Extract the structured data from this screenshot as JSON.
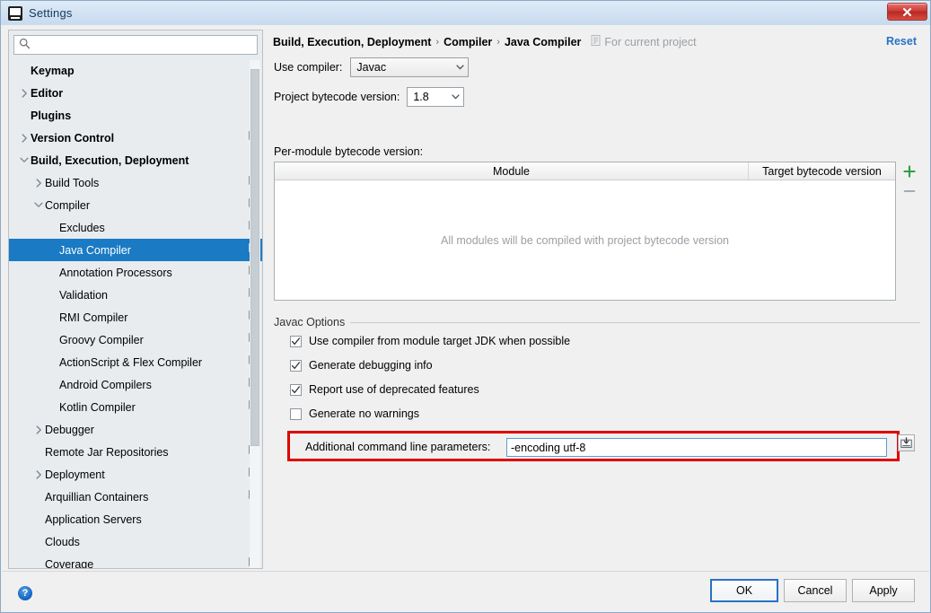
{
  "window": {
    "title": "Settings",
    "app_icon": "intellij-idea-icon",
    "close_label": "close-icon"
  },
  "sidebar": {
    "search": {
      "value": "",
      "placeholder": ""
    },
    "items": [
      {
        "label": "Keymap",
        "indent": 0,
        "arrow": "none",
        "bold": true,
        "copy": false,
        "selected": false
      },
      {
        "label": "Editor",
        "indent": 0,
        "arrow": "collapsed",
        "bold": true,
        "copy": false,
        "selected": false
      },
      {
        "label": "Plugins",
        "indent": 0,
        "arrow": "none",
        "bold": true,
        "copy": false,
        "selected": false
      },
      {
        "label": "Version Control",
        "indent": 0,
        "arrow": "collapsed",
        "bold": true,
        "copy": true,
        "selected": false
      },
      {
        "label": "Build, Execution, Deployment",
        "indent": 0,
        "arrow": "expanded",
        "bold": true,
        "copy": false,
        "selected": false
      },
      {
        "label": "Build Tools",
        "indent": 1,
        "arrow": "collapsed",
        "bold": false,
        "copy": true,
        "selected": false
      },
      {
        "label": "Compiler",
        "indent": 1,
        "arrow": "expanded",
        "bold": false,
        "copy": true,
        "selected": false
      },
      {
        "label": "Excludes",
        "indent": 2,
        "arrow": "none",
        "bold": false,
        "copy": true,
        "selected": false
      },
      {
        "label": "Java Compiler",
        "indent": 2,
        "arrow": "none",
        "bold": false,
        "copy": true,
        "selected": true
      },
      {
        "label": "Annotation Processors",
        "indent": 2,
        "arrow": "none",
        "bold": false,
        "copy": true,
        "selected": false
      },
      {
        "label": "Validation",
        "indent": 2,
        "arrow": "none",
        "bold": false,
        "copy": true,
        "selected": false
      },
      {
        "label": "RMI Compiler",
        "indent": 2,
        "arrow": "none",
        "bold": false,
        "copy": true,
        "selected": false
      },
      {
        "label": "Groovy Compiler",
        "indent": 2,
        "arrow": "none",
        "bold": false,
        "copy": true,
        "selected": false
      },
      {
        "label": "ActionScript & Flex Compiler",
        "indent": 2,
        "arrow": "none",
        "bold": false,
        "copy": true,
        "selected": false
      },
      {
        "label": "Android Compilers",
        "indent": 2,
        "arrow": "none",
        "bold": false,
        "copy": true,
        "selected": false
      },
      {
        "label": "Kotlin Compiler",
        "indent": 2,
        "arrow": "none",
        "bold": false,
        "copy": true,
        "selected": false
      },
      {
        "label": "Debugger",
        "indent": 1,
        "arrow": "collapsed",
        "bold": false,
        "copy": false,
        "selected": false
      },
      {
        "label": "Remote Jar Repositories",
        "indent": 1,
        "arrow": "none",
        "bold": false,
        "copy": true,
        "selected": false
      },
      {
        "label": "Deployment",
        "indent": 1,
        "arrow": "collapsed",
        "bold": false,
        "copy": true,
        "selected": false
      },
      {
        "label": "Arquillian Containers",
        "indent": 1,
        "arrow": "none",
        "bold": false,
        "copy": true,
        "selected": false
      },
      {
        "label": "Application Servers",
        "indent": 1,
        "arrow": "none",
        "bold": false,
        "copy": false,
        "selected": false
      },
      {
        "label": "Clouds",
        "indent": 1,
        "arrow": "none",
        "bold": false,
        "copy": false,
        "selected": false
      },
      {
        "label": "Coverage",
        "indent": 1,
        "arrow": "none",
        "bold": false,
        "copy": true,
        "selected": false
      }
    ]
  },
  "main": {
    "breadcrumb": [
      "Build, Execution, Deployment",
      "Compiler",
      "Java Compiler"
    ],
    "breadcrumb_separator": "›",
    "scope_label": "For current project",
    "scope_icon": "project-scope-icon",
    "reset_label": "Reset",
    "use_compiler": {
      "label": "Use compiler:",
      "value": "Javac"
    },
    "project_bytecode": {
      "label": "Project bytecode version:",
      "value": "1.8"
    },
    "per_module": {
      "label": "Per-module bytecode version:",
      "columns": [
        "Module",
        "Target bytecode version"
      ],
      "empty_text": "All modules will be compiled with project bytecode version",
      "add_label": "+",
      "remove_label": "−"
    },
    "javac_options": {
      "title": "Javac Options",
      "checkboxes": [
        {
          "label": "Use compiler from module target JDK when possible",
          "checked": true
        },
        {
          "label": "Generate debugging info",
          "checked": true
        },
        {
          "label": "Report use of deprecated features",
          "checked": true
        },
        {
          "label": "Generate no warnings",
          "checked": false
        }
      ],
      "additional_params": {
        "label": "Additional command line parameters:",
        "value": "-encoding utf-8",
        "placeholder": "",
        "expand_icon": "insert-macro-icon"
      }
    }
  },
  "footer": {
    "help_label": "?",
    "ok_label": "OK",
    "cancel_label": "Cancel",
    "apply_label": "Apply"
  },
  "colors": {
    "selection_blue": "#1a7ac4",
    "link_blue": "#2a72c4",
    "highlight_red": "#e00000",
    "focus_border": "#5b9bd5",
    "add_green": "#2f9e44"
  }
}
